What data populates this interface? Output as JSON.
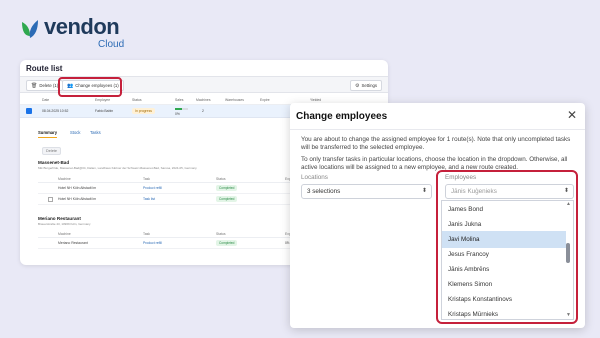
{
  "brand": {
    "name": "vendon",
    "sub": "Cloud",
    "accent": "#1f3a5b",
    "mark_colors": [
      "#2fa84f",
      "#2c6bb5"
    ]
  },
  "route_list": {
    "title": "Route list",
    "toolbar": {
      "delete_label": "Delete (1)",
      "change_label": "Change employees (1)",
      "settings_label": "Settings"
    },
    "columns": [
      "Date",
      "Employee",
      "Status",
      "Sales",
      "Machines",
      "Warehouses",
      "Expire",
      "Yielded"
    ],
    "row": {
      "date": "08.04.2025 10:52",
      "employee": "Fabio Babin",
      "status": "In progress",
      "sales_fill": 0.5,
      "sales": "0%",
      "machines": "2"
    },
    "subtabs": [
      "Summary",
      "Stock",
      "Tasks"
    ],
    "sub_delete": "Delete",
    "loc1": {
      "name": "Massenet-Bad",
      "addr": "Mik Burgerhlde, Massenet-Bad@04, Dalam, Landhaus Kärtner der Schweiz-Massenet-Bad, Samoa, 2024-05, Germany",
      "headers": [
        "Machine",
        "Task",
        "Status",
        "Expire"
      ],
      "rows": [
        {
          "machine": "Hotel NH Köln Altstadt lm",
          "task": "Product refill",
          "status": "Completed",
          "expire": ""
        },
        {
          "machine": "Hotel NH Köln Altstadt lm",
          "task": "Task list",
          "status": "Completed",
          "expire": ""
        }
      ]
    },
    "loc2": {
      "name": "Meriano Restaurant",
      "addr": "Brauerstraße 43, 10969 Köln, Germany",
      "headers": [
        "Machine",
        "Task",
        "Status",
        "Expire"
      ],
      "rows": [
        {
          "machine": "Meriano Restaurant",
          "task": "Product refill",
          "status": "Completed",
          "expire": "09.04.2025 10:30"
        }
      ]
    }
  },
  "modal": {
    "title": "Change employees",
    "p1": "You are about to change the assigned employee for 1 route(s). Note that only uncompleted tasks will be transferred to the selected employee.",
    "p2": "To only transfer tasks in particular locations, choose the location in the dropdown. Otherwise, all active locations will be assigned to a new employee, and a new route created.",
    "locations_label": "Locations",
    "locations_value": "3 selections",
    "employees_label": "Employees",
    "employees_placeholder": "Jānis Kuģenieks",
    "options": [
      "James Bond",
      "Janis Jukna",
      "Javi Molina",
      "Jesus Francoy",
      "Jānis Ambrēns",
      "Klemens Simon",
      "Kristaps Konstantinovs",
      "Kristaps Mūrnieks"
    ],
    "selected_option": "Javi Molina",
    "highlight_color": "#c5203b"
  }
}
